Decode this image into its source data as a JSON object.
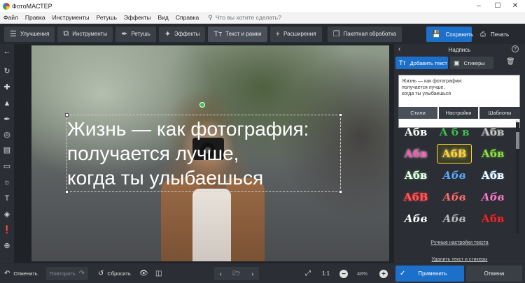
{
  "window": {
    "title": "ФотоМАСТЕР",
    "minimize_icon": "minimize-icon",
    "maximize_icon": "maximize-icon",
    "close_icon": "close-icon"
  },
  "menu": {
    "items": [
      "Файл",
      "Правка",
      "Инструменты",
      "Ретушь",
      "Эффекты",
      "Вид",
      "Справка"
    ],
    "search_placeholder": "Что вы хотите сделать?"
  },
  "toolbar": {
    "tabs": [
      {
        "label": "Улучшения",
        "icon": "sliders-icon"
      },
      {
        "label": "Инструменты",
        "icon": "crop-icon"
      },
      {
        "label": "Ретушь",
        "icon": "brush-icon"
      },
      {
        "label": "Эффекты",
        "icon": "magic-wand-icon"
      },
      {
        "label": "Текст и рамки",
        "icon": "text-icon",
        "active": true
      },
      {
        "label": "Расширения",
        "icon": "plus-icon"
      },
      {
        "label": "Пакетная обработка",
        "icon": "batch-icon"
      }
    ],
    "save_label": "Сохранить",
    "print_label": "Печать"
  },
  "left_tools": [
    "back-arrow-icon",
    "rotate-icon",
    "heal-icon",
    "stamp-icon",
    "brush-icon",
    "radial-filter-icon",
    "gradient-icon",
    "vignette-icon",
    "light-icon",
    "text-tool-icon",
    "fill-icon",
    "pipette-icon",
    "globe-icon"
  ],
  "canvas": {
    "caption_lines": [
      "Жизнь — как фотография:",
      "получается лучше,",
      "когда ты улыбаешься"
    ]
  },
  "right_panel": {
    "title": "Надпись",
    "add_text_label": "Добавить текст",
    "stickers_label": "Стикеры",
    "text_value_lines": [
      "Жизнь — как фотографии:",
      "получается лучше,",
      "когда ты улыбаешься"
    ],
    "subtabs": [
      "Стили",
      "Настройки",
      "Шаблоны"
    ],
    "style_swatches": [
      {
        "text": "Абв",
        "color": "#ffffff"
      },
      {
        "text": "А б в",
        "color": "#3fbf4a"
      },
      {
        "text": "Абв",
        "color": "#d8d8d8"
      },
      {
        "text": "Абв",
        "color": "#ff4fb0"
      },
      {
        "text": "АбВ",
        "color": "#ffd43b"
      },
      {
        "text": "Абв",
        "color": "#8fe04a"
      },
      {
        "text": "Абв",
        "color": "#ffffff"
      },
      {
        "text": "Абв",
        "color": "#5aa9ff"
      },
      {
        "text": "Абв",
        "color": "#ffffff"
      },
      {
        "text": "АбВ",
        "color": "#ff5a5a"
      },
      {
        "text": "Абв",
        "color": "#ff6b6b"
      },
      {
        "text": "Абв",
        "color": "#ff77c8"
      },
      {
        "text": "Абв",
        "color": "#ffffff"
      },
      {
        "text": "Абв",
        "color": "#bbbbbb"
      },
      {
        "text": "Абв",
        "color": "#d43030"
      }
    ],
    "manual_settings_link": "Ручные настройки текста",
    "delete_link": "Удалить текст и стикеры"
  },
  "bottom_bar": {
    "undo_label": "Отменить",
    "redo_label": "Повторить",
    "reset_label": "Сбросить",
    "zoom_11": "1:1",
    "zoom_value": "48%",
    "apply_label": "Применить",
    "cancel_label": "Отмена"
  }
}
